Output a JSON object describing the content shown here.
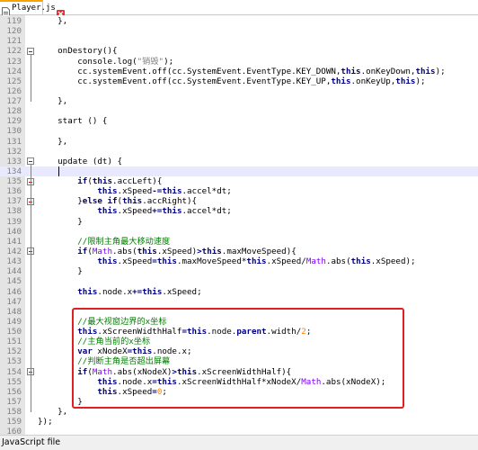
{
  "tab": {
    "label": "Player.js",
    "icon": "js-file-icon",
    "close_icon": "close-icon"
  },
  "status": {
    "file_type": "JavaScript file"
  },
  "colors": {
    "keyword": "#000080",
    "comment": "#008000",
    "number": "#ff8000",
    "string": "#808080",
    "math": "#8000ff",
    "highlight": "#e02020",
    "gutter": "#e4e4e4"
  },
  "current_line": 134,
  "highlight_range": [
    149,
    157
  ],
  "lines": [
    {
      "n": "119",
      "tokens": [
        [
          "p",
          "    },"
        ]
      ]
    },
    {
      "n": "120",
      "tokens": []
    },
    {
      "n": "121",
      "tokens": []
    },
    {
      "n": "122",
      "tokens": [
        [
          "p",
          "    onDestory(){"
        ]
      ]
    },
    {
      "n": "123",
      "tokens": [
        [
          "p",
          "        console.log("
        ],
        [
          "s",
          "\"销毁\""
        ],
        [
          "p",
          ");"
        ]
      ]
    },
    {
      "n": "124",
      "tokens": [
        [
          "p",
          "        cc.systemEvent.off(cc.SystemEvent.EventType.KEY_DOWN,"
        ],
        [
          "k",
          "this"
        ],
        [
          "p",
          "."
        ],
        [
          "p",
          "onKeyDown,"
        ],
        [
          "k",
          "this"
        ],
        [
          "p",
          ");"
        ]
      ]
    },
    {
      "n": "125",
      "tokens": [
        [
          "p",
          "        cc.systemEvent.off(cc.SystemEvent.EventType.KEY_UP,"
        ],
        [
          "k",
          "this"
        ],
        [
          "p",
          ".onKeyUp,"
        ],
        [
          "k",
          "this"
        ],
        [
          "p",
          ");"
        ]
      ]
    },
    {
      "n": "126",
      "tokens": []
    },
    {
      "n": "127",
      "tokens": [
        [
          "p",
          "    },"
        ]
      ]
    },
    {
      "n": "128",
      "tokens": []
    },
    {
      "n": "129",
      "tokens": [
        [
          "p",
          "    start () {"
        ]
      ]
    },
    {
      "n": "130",
      "tokens": []
    },
    {
      "n": "131",
      "tokens": [
        [
          "p",
          "    },"
        ]
      ]
    },
    {
      "n": "132",
      "tokens": []
    },
    {
      "n": "133",
      "tokens": [
        [
          "p",
          "    update (dt) {"
        ]
      ]
    },
    {
      "n": "134",
      "tokens": []
    },
    {
      "n": "135",
      "tokens": [
        [
          "p",
          "        "
        ],
        [
          "k",
          "if"
        ],
        [
          "p",
          "("
        ],
        [
          "k",
          "this"
        ],
        [
          "p",
          ".accLeft){"
        ]
      ]
    },
    {
      "n": "136",
      "tokens": [
        [
          "p",
          "            "
        ],
        [
          "k",
          "this"
        ],
        [
          "p",
          ".xSpeed"
        ],
        [
          "o",
          "-="
        ],
        [
          "k",
          "this"
        ],
        [
          "p",
          ".accel*dt;"
        ]
      ]
    },
    {
      "n": "137",
      "tokens": [
        [
          "p",
          "        }"
        ],
        [
          "k",
          "else if"
        ],
        [
          "p",
          "("
        ],
        [
          "k",
          "this"
        ],
        [
          "p",
          ".accRight){"
        ]
      ]
    },
    {
      "n": "138",
      "tokens": [
        [
          "p",
          "            "
        ],
        [
          "k",
          "this"
        ],
        [
          "p",
          ".xSpeed"
        ],
        [
          "o",
          "+="
        ],
        [
          "k",
          "this"
        ],
        [
          "p",
          ".accel*dt;"
        ]
      ]
    },
    {
      "n": "139",
      "tokens": [
        [
          "p",
          "        }"
        ]
      ]
    },
    {
      "n": "140",
      "tokens": []
    },
    {
      "n": "141",
      "tokens": [
        [
          "p",
          "        "
        ],
        [
          "c",
          "//限制主角最大移动速度"
        ]
      ]
    },
    {
      "n": "142",
      "tokens": [
        [
          "p",
          "        "
        ],
        [
          "k",
          "if"
        ],
        [
          "p",
          "("
        ],
        [
          "m",
          "Math"
        ],
        [
          "p",
          ".abs("
        ],
        [
          "k",
          "this"
        ],
        [
          "p",
          ".xSpeed)"
        ],
        [
          "o",
          ">"
        ],
        [
          "k",
          "this"
        ],
        [
          "p",
          ".maxMoveSpeed){"
        ]
      ]
    },
    {
      "n": "143",
      "tokens": [
        [
          "p",
          "            "
        ],
        [
          "k",
          "this"
        ],
        [
          "p",
          ".xSpeed"
        ],
        [
          "o",
          "="
        ],
        [
          "k",
          "this"
        ],
        [
          "p",
          ".maxMoveSpeed*"
        ],
        [
          "k",
          "this"
        ],
        [
          "p",
          ".xSpeed/"
        ],
        [
          "m",
          "Math"
        ],
        [
          "p",
          ".abs("
        ],
        [
          "k",
          "this"
        ],
        [
          "p",
          ".xSpeed);"
        ]
      ]
    },
    {
      "n": "144",
      "tokens": [
        [
          "p",
          "        }"
        ]
      ]
    },
    {
      "n": "145",
      "tokens": []
    },
    {
      "n": "146",
      "tokens": [
        [
          "p",
          "        "
        ],
        [
          "k",
          "this"
        ],
        [
          "p",
          ".node.x"
        ],
        [
          "o",
          "+="
        ],
        [
          "k",
          "this"
        ],
        [
          "p",
          ".xSpeed;"
        ]
      ]
    },
    {
      "n": "147",
      "tokens": []
    },
    {
      "n": "148",
      "tokens": []
    },
    {
      "n": "149",
      "tokens": [
        [
          "p",
          "        "
        ],
        [
          "c",
          "//最大视窗边界的x坐标"
        ]
      ]
    },
    {
      "n": "150",
      "tokens": [
        [
          "p",
          "        "
        ],
        [
          "k",
          "this"
        ],
        [
          "p",
          ".xScreenWidthHalf"
        ],
        [
          "o",
          "="
        ],
        [
          "k",
          "this"
        ],
        [
          "p",
          ".node."
        ],
        [
          "k",
          "parent"
        ],
        [
          "p",
          ".width/"
        ],
        [
          "n",
          "2"
        ],
        [
          "p",
          ";"
        ]
      ]
    },
    {
      "n": "151",
      "tokens": [
        [
          "p",
          "        "
        ],
        [
          "c",
          "//主角当前的x坐标"
        ]
      ]
    },
    {
      "n": "152",
      "tokens": [
        [
          "p",
          "        "
        ],
        [
          "k",
          "var"
        ],
        [
          "p",
          " xNodeX"
        ],
        [
          "o",
          "="
        ],
        [
          "k",
          "this"
        ],
        [
          "p",
          ".node.x;"
        ]
      ]
    },
    {
      "n": "153",
      "tokens": [
        [
          "p",
          "        "
        ],
        [
          "c",
          "//判断主角是否超出屏幕"
        ]
      ]
    },
    {
      "n": "154",
      "tokens": [
        [
          "p",
          "        "
        ],
        [
          "k",
          "if"
        ],
        [
          "p",
          "("
        ],
        [
          "m",
          "Math"
        ],
        [
          "p",
          ".abs(xNodeX)"
        ],
        [
          "o",
          ">"
        ],
        [
          "k",
          "this"
        ],
        [
          "p",
          ".xScreenWidthHalf){"
        ]
      ]
    },
    {
      "n": "155",
      "tokens": [
        [
          "p",
          "            "
        ],
        [
          "k",
          "this"
        ],
        [
          "p",
          ".node.x"
        ],
        [
          "o",
          "="
        ],
        [
          "k",
          "this"
        ],
        [
          "p",
          ".xScreenWidthHalf*xNodeX/"
        ],
        [
          "m",
          "Math"
        ],
        [
          "p",
          ".abs(xNodeX);"
        ]
      ]
    },
    {
      "n": "156",
      "tokens": [
        [
          "p",
          "            "
        ],
        [
          "k",
          "this"
        ],
        [
          "p",
          ".xSpeed"
        ],
        [
          "o",
          "="
        ],
        [
          "n",
          "0"
        ],
        [
          "p",
          ";"
        ]
      ]
    },
    {
      "n": "157",
      "tokens": [
        [
          "p",
          "        }"
        ]
      ]
    },
    {
      "n": "158",
      "tokens": [
        [
          "p",
          "    },"
        ]
      ]
    },
    {
      "n": "159",
      "tokens": [
        [
          "p",
          "});"
        ]
      ]
    },
    {
      "n": "160",
      "tokens": []
    }
  ]
}
